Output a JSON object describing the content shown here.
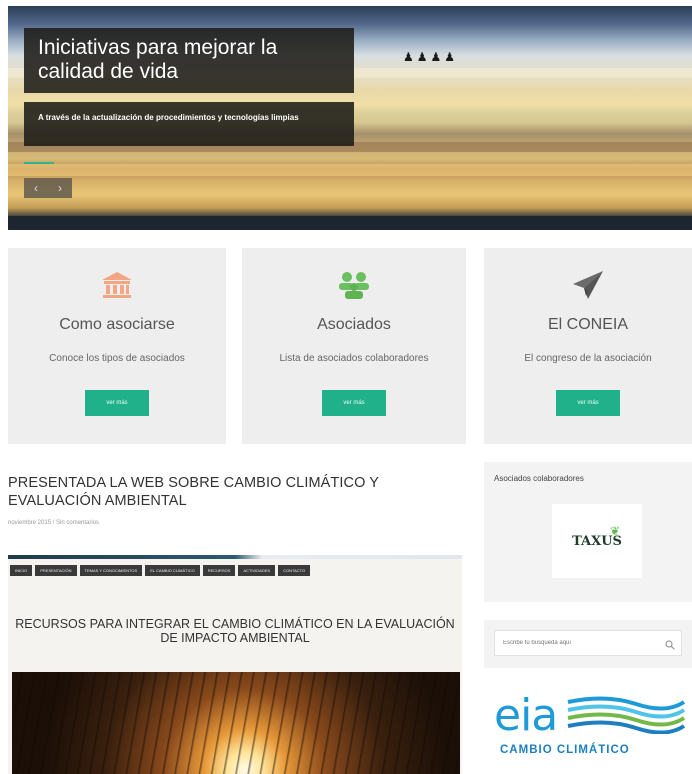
{
  "hero": {
    "title": "Iniciativas para mejorar la calidad de vida",
    "subtitle": "A través de la actualización de procedimientos y tecnologías limpias",
    "prev_glyph": "‹",
    "next_glyph": "›"
  },
  "features": [
    {
      "icon": "bank-icon",
      "title": "Como asociarse",
      "description": "Conoce los tipos de asociados",
      "button": "ver más",
      "color": "#f4a583"
    },
    {
      "icon": "users-icon",
      "title": "Asociados",
      "description": "Lista de asociados colaboradores",
      "button": "ver más",
      "color": "#6abf5e"
    },
    {
      "icon": "paper-plane-icon",
      "title": "El CONEIA",
      "description": "El congreso de la asociación",
      "button": "ver más",
      "color": "#6b6b6b"
    }
  ],
  "article": {
    "title": "PRESENTADA LA WEB SOBRE CAMBIO CLIMÁTICO Y EVALUACIÓN AMBIENTAL",
    "meta": "noviembre 2015 / Sin comentarios",
    "embed": {
      "nav": [
        "INICIO",
        "PRESENTACIÓN",
        "TEMAS Y CONOCIMIENTOS",
        "EL CAMBIO CLIMÁTICO",
        "RECURSOS",
        "ACTIVIDADES",
        "CONTACTO"
      ],
      "heading": "RECURSOS PARA INTEGRAR EL CAMBIO CLIMÁTICO EN LA EVALUACIÓN DE IMPACTO AMBIENTAL"
    }
  },
  "sidebar": {
    "widget_title": "Asociados colaboradores",
    "partner_logo_text": "TAXUS",
    "search_placeholder": "Escribe tu búsqueda aquí",
    "eia_logo": "eia",
    "eia_caption": "CAMBIO CLIMÁTICO"
  },
  "colors": {
    "accent": "#20b08a",
    "feature_bg": "#eeeeee",
    "eia_blue": "#1e9ad8"
  }
}
